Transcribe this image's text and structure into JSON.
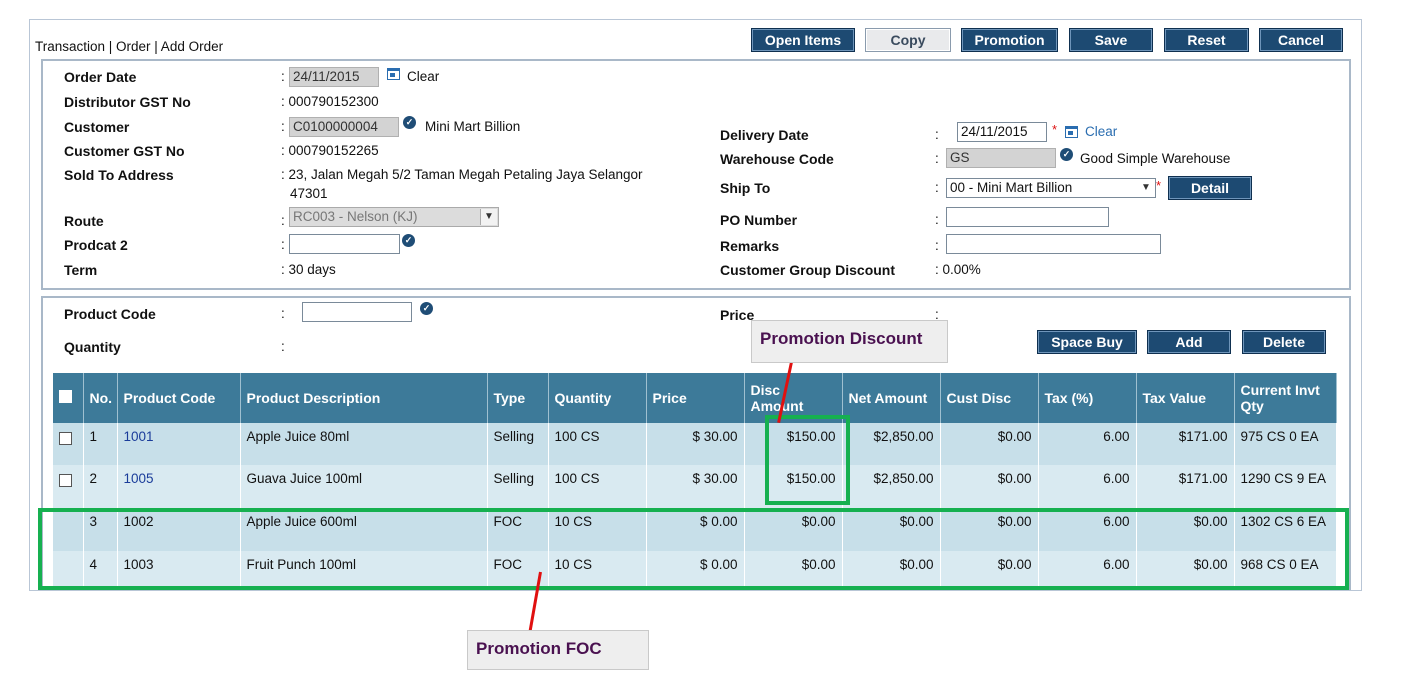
{
  "breadcrumb": "Transaction | Order | Add Order",
  "toolbar": {
    "open_items": "Open Items",
    "copy": "Copy",
    "promotion": "Promotion",
    "save": "Save",
    "reset": "Reset",
    "cancel": "Cancel"
  },
  "header": {
    "order_date_label": "Order Date",
    "order_date_value": "24/11/2015",
    "clear_label": "Clear",
    "distributor_gst_label": "Distributor GST No",
    "distributor_gst_value": ": 000790152300",
    "customer_label": "Customer",
    "customer_code": "C0100000004",
    "customer_name": "Mini Mart Billion",
    "customer_gst_label": "Customer GST No",
    "customer_gst_value": ": 000790152265",
    "sold_to_label": "Sold To Address",
    "sold_to_line1": ": 23, Jalan Megah 5/2 Taman Megah Petaling Jaya Selangor",
    "sold_to_line2": "47301",
    "route_label": "Route",
    "route_value": "RC003 - Nelson (KJ)",
    "prodcat_label": "Prodcat 2",
    "prodcat_value": "",
    "term_label": "Term",
    "term_value": ": 30 days",
    "delivery_date_label": "Delivery Date",
    "delivery_date_value": "24/11/2015",
    "delivery_clear": "Clear",
    "warehouse_label": "Warehouse Code",
    "warehouse_code": "GS",
    "warehouse_name": "Good Simple Warehouse",
    "ship_to_label": "Ship To",
    "ship_to_value": "00 - Mini Mart Billion",
    "detail_button": "Detail",
    "po_label": "PO Number",
    "po_value": "",
    "remarks_label": "Remarks",
    "remarks_value": "",
    "cgd_label": "Customer Group Discount",
    "cgd_value": ": 0.00%",
    "colon": ":"
  },
  "entry": {
    "product_code_label": "Product Code",
    "product_code_value": "",
    "quantity_label": "Quantity",
    "price_label": "Price",
    "space_buy": "Space Buy",
    "add": "Add",
    "delete": "Delete"
  },
  "table": {
    "columns": [
      "No.",
      "Product Code",
      "Product Description",
      "Type",
      "Quantity",
      "Price",
      "Disc Amount",
      "Net Amount",
      "Cust Disc",
      "Tax (%)",
      "Tax Value",
      "Current Invt Qty"
    ],
    "rows": [
      {
        "no": "1",
        "code": "1001",
        "desc": "Apple Juice 80ml",
        "type": "Selling",
        "qty": "100 CS",
        "price": "$ 30.00",
        "disc": "$150.00",
        "net": "$2,850.00",
        "cust_disc": "$0.00",
        "tax": "6.00",
        "tax_value": "$171.00",
        "invt": "975 CS 0 EA"
      },
      {
        "no": "2",
        "code": "1005",
        "desc": "Guava Juice 100ml",
        "type": "Selling",
        "qty": "100 CS",
        "price": "$ 30.00",
        "disc": "$150.00",
        "net": "$2,850.00",
        "cust_disc": "$0.00",
        "tax": "6.00",
        "tax_value": "$171.00",
        "invt": "1290 CS 9 EA"
      },
      {
        "no": "3",
        "code": "1002",
        "desc": "Apple Juice 600ml",
        "type": "FOC",
        "qty": "10 CS",
        "price": "$ 0.00",
        "disc": "$0.00",
        "net": "$0.00",
        "cust_disc": "$0.00",
        "tax": "6.00",
        "tax_value": "$0.00",
        "invt": "1302 CS 6 EA"
      },
      {
        "no": "4",
        "code": "1003",
        "desc": "Fruit Punch 100ml",
        "type": "FOC",
        "qty": "10 CS",
        "price": "$ 0.00",
        "disc": "$0.00",
        "net": "$0.00",
        "cust_disc": "$0.00",
        "tax": "6.00",
        "tax_value": "$0.00",
        "invt": "968 CS 0 EA"
      }
    ]
  },
  "annotations": {
    "promotion_discount": "Promotion Discount",
    "promotion_foc": "Promotion FOC",
    "highlight_color": "#16b050",
    "pointer_color": "#e01010"
  },
  "colors": {
    "button_bg": "#1d4a72",
    "table_header": "#3d7a99",
    "row_alt_1": "#c7dfe9",
    "row_alt_2": "#d9eaf1"
  }
}
